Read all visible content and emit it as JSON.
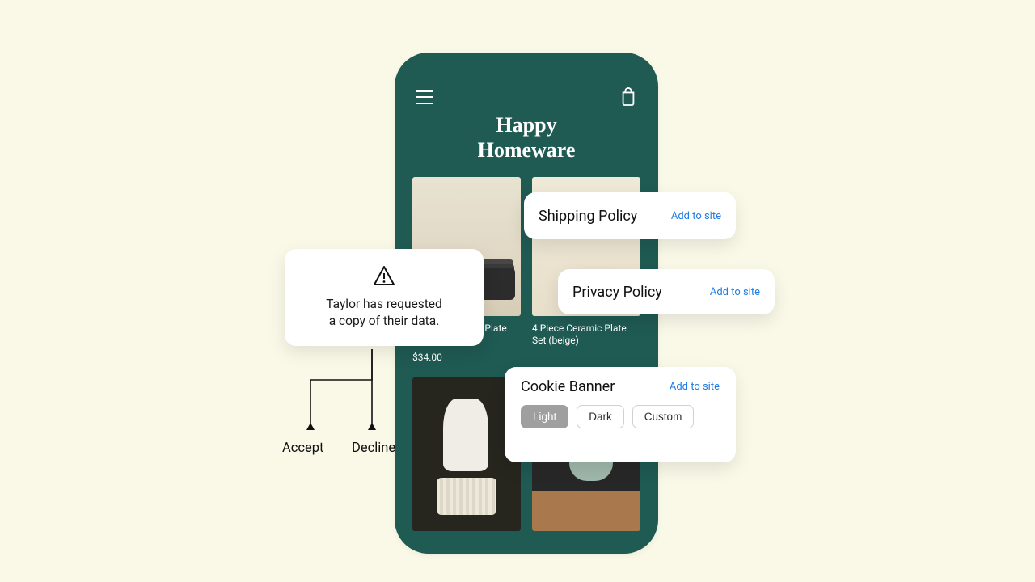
{
  "phone": {
    "brand_line1": "Happy",
    "brand_line2": "Homeware",
    "products": [
      {
        "title": "4 Piece Ceramic Plate Set",
        "price": "$34.00"
      },
      {
        "title": "4 Piece Ceramic Plate Set (beige)",
        "price": ""
      },
      {
        "title": "",
        "price": ""
      },
      {
        "title": "",
        "price": ""
      }
    ]
  },
  "shipping_card": {
    "title": "Shipping Policy",
    "action": "Add to site"
  },
  "privacy_card": {
    "title": "Privacy Policy",
    "action": "Add to site"
  },
  "cookie_card": {
    "title": "Cookie Banner",
    "action": "Add to site",
    "options": {
      "light": "Light",
      "dark": "Dark",
      "custom": "Custom"
    }
  },
  "data_request": {
    "line1": "Taylor has requested",
    "line2": "a copy of their data."
  },
  "choices": {
    "accept": "Accept",
    "decline": "Decline"
  }
}
